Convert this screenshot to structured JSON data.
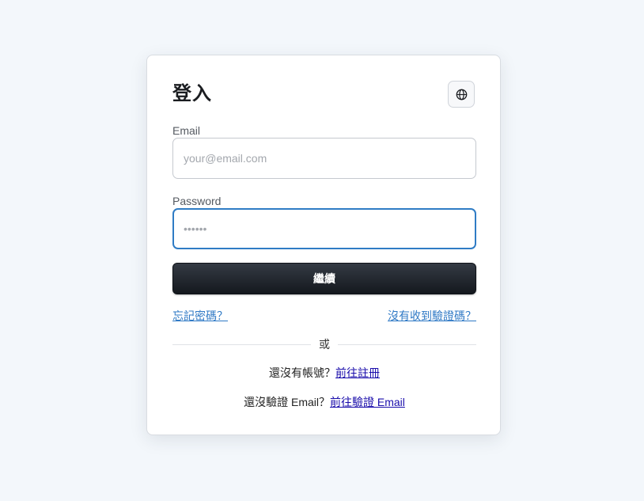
{
  "login": {
    "title": "登入",
    "language_icon": "globe-icon",
    "email": {
      "label": "Email",
      "placeholder": "your@email.com",
      "value": ""
    },
    "password": {
      "label": "Password",
      "placeholder": "••••••",
      "value": ""
    },
    "submit_label": "繼續",
    "forgot_password": "忘記密碼？",
    "no_code": "沒有收到驗證碼？",
    "divider": "或",
    "register_prompt": "還沒有帳號？",
    "register_link": "前往註冊",
    "verify_prompt": "還沒驗證 Email？",
    "verify_link": "前往驗證 Email"
  },
  "colors": {
    "page_bg": "#f3f7fb",
    "accent": "#2f7cc5",
    "link": "#2f79c5",
    "button_bg": "#1f242b"
  }
}
